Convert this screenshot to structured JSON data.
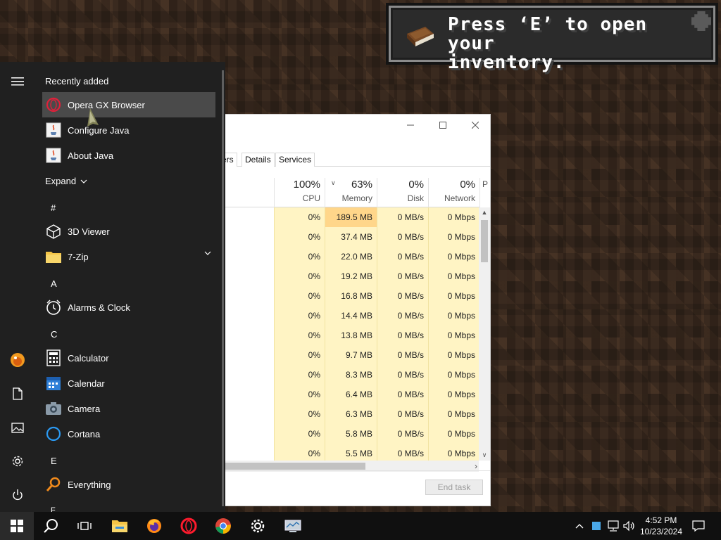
{
  "toast": {
    "message_line1": "Press ‘E’ to open your",
    "message_line2": "inventory."
  },
  "task_manager": {
    "tabs": [
      "ers",
      "Details",
      "Services"
    ],
    "columns": [
      {
        "percent": "100%",
        "label": "CPU"
      },
      {
        "percent": "63%",
        "label": "Memory"
      },
      {
        "percent": "0%",
        "label": "Disk"
      },
      {
        "percent": "0%",
        "label": "Network"
      },
      {
        "percent": "",
        "label": "P"
      }
    ],
    "rows": [
      {
        "cpu": "0%",
        "memory": "189.5 MB",
        "disk": "0 MB/s",
        "network": "0 Mbps"
      },
      {
        "cpu": "0%",
        "memory": "37.4 MB",
        "disk": "0 MB/s",
        "network": "0 Mbps"
      },
      {
        "cpu": "0%",
        "memory": "22.0 MB",
        "disk": "0 MB/s",
        "network": "0 Mbps"
      },
      {
        "cpu": "0%",
        "memory": "19.2 MB",
        "disk": "0 MB/s",
        "network": "0 Mbps"
      },
      {
        "cpu": "0%",
        "memory": "16.8 MB",
        "disk": "0 MB/s",
        "network": "0 Mbps"
      },
      {
        "cpu": "0%",
        "memory": "14.4 MB",
        "disk": "0 MB/s",
        "network": "0 Mbps"
      },
      {
        "cpu": "0%",
        "memory": "13.8 MB",
        "disk": "0 MB/s",
        "network": "0 Mbps"
      },
      {
        "cpu": "0%",
        "memory": "9.7 MB",
        "disk": "0 MB/s",
        "network": "0 Mbps"
      },
      {
        "cpu": "0%",
        "memory": "8.3 MB",
        "disk": "0 MB/s",
        "network": "0 Mbps"
      },
      {
        "cpu": "0%",
        "memory": "6.4 MB",
        "disk": "0 MB/s",
        "network": "0 Mbps"
      },
      {
        "cpu": "0%",
        "memory": "6.3 MB",
        "disk": "0 MB/s",
        "network": "0 Mbps"
      },
      {
        "cpu": "0%",
        "memory": "5.8 MB",
        "disk": "0 MB/s",
        "network": "0 Mbps"
      },
      {
        "cpu": "0%",
        "memory": "5.5 MB",
        "disk": "0 MB/s",
        "network": "0 Mbps"
      }
    ],
    "end_task_label": "End task"
  },
  "start_menu": {
    "recently_added_label": "Recently added",
    "recent_apps": [
      {
        "name": "Opera GX Browser",
        "icon": "opera-gx-icon"
      },
      {
        "name": "Configure Java",
        "icon": "java-icon"
      },
      {
        "name": "About Java",
        "icon": "java-icon"
      }
    ],
    "expand_label": "Expand",
    "letters": {
      "hash": "#",
      "a": "A",
      "c": "C",
      "e": "E"
    },
    "apps": {
      "viewer3d": "3D Viewer",
      "zip": "7-Zip",
      "alarms": "Alarms & Clock",
      "calculator": "Calculator",
      "calendar": "Calendar",
      "camera": "Camera",
      "cortana": "Cortana",
      "everything": "Everything"
    }
  },
  "taskbar": {
    "time": "4:52 PM",
    "date": "10/23/2024"
  },
  "colors": {
    "memory_highlight": "#ffd68a",
    "usage_fill": "#fff4c4",
    "start_bg": "#202020"
  }
}
